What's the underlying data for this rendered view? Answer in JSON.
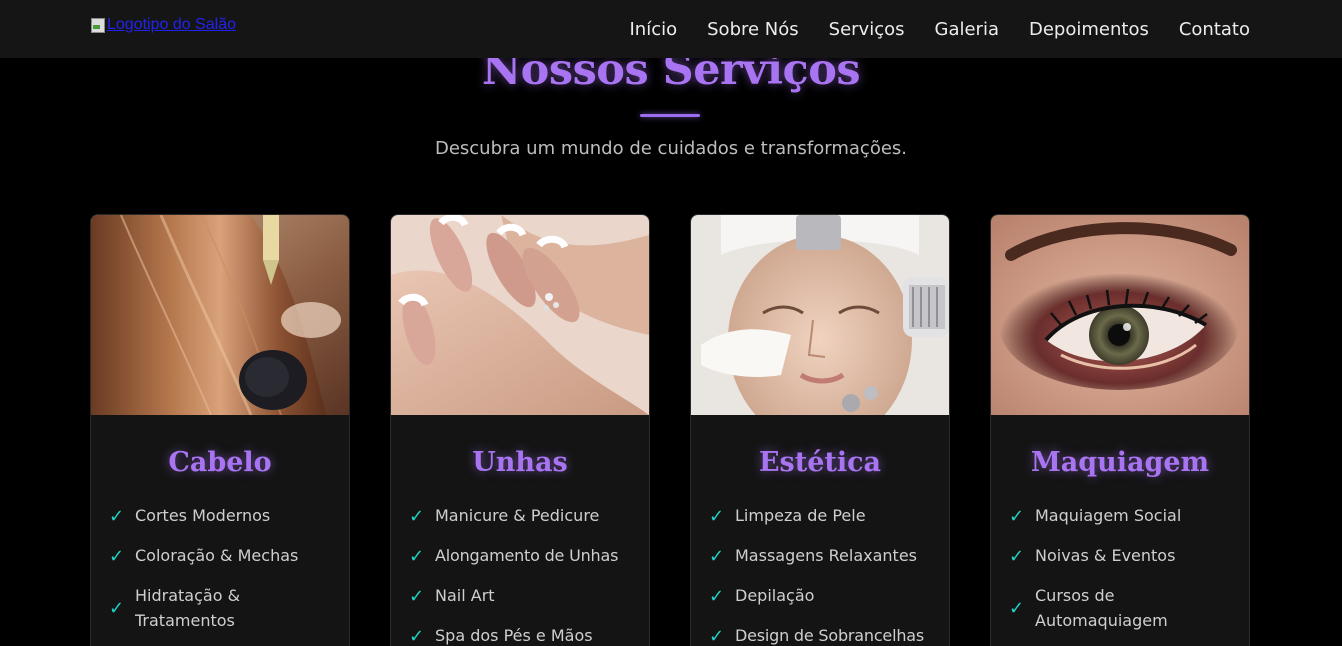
{
  "header": {
    "logo_alt": "Logotipo do Salão",
    "nav": [
      "Início",
      "Sobre Nós",
      "Serviços",
      "Galeria",
      "Depoimentos",
      "Contato"
    ]
  },
  "section": {
    "title": "Nossos Serviços",
    "subtitle": "Descubra um mundo de cuidados e transformações."
  },
  "cards": [
    {
      "title": "Cabelo",
      "items": [
        "Cortes Modernos",
        "Coloração & Mechas",
        "Hidratação & Tratamentos"
      ]
    },
    {
      "title": "Unhas",
      "items": [
        "Manicure & Pedicure",
        "Alongamento de Unhas",
        "Nail Art",
        "Spa dos Pés e Mãos"
      ]
    },
    {
      "title": "Estética",
      "items": [
        "Limpeza de Pele",
        "Massagens Relaxantes",
        "Depilação",
        "Design de Sobrancelhas"
      ]
    },
    {
      "title": "Maquiagem",
      "items": [
        "Maquiagem Social",
        "Noivas & Eventos",
        "Cursos de Automaquiagem"
      ]
    }
  ],
  "icons": {
    "check": "check-icon",
    "logo": "broken-image-icon"
  },
  "colors": {
    "accent_purple": "#a874f2",
    "check_teal": "#1fd3c6",
    "background": "#000000",
    "header_bg": "#151515",
    "card_bg": "#141414"
  }
}
